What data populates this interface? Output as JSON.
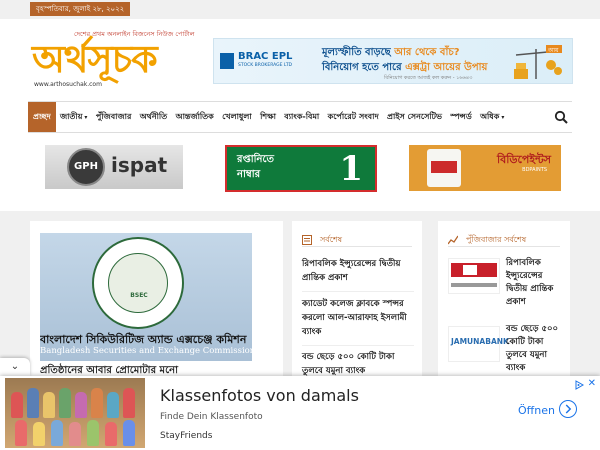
{
  "topbar": {
    "date": "বৃহস্পতিবার, জুলাই ২৮, ২০২২"
  },
  "header": {
    "logo_tagline": "দেশের প্রথম অনলাইন বিজনেস নিউজ পোর্টাল",
    "logo_text": "অর্থসূচক",
    "logo_url": "www.arthosuchak.com",
    "banner": {
      "brand": "BRAC EPL",
      "brand_sub": "STOCK BROKERAGE LTD",
      "line1_a": "মূল্যস্ফীতি বাড়ছে",
      "line1_b": "আর থেকে বাঁচ?",
      "line2_a": "বিনিয়োগ হতে পারে",
      "line2_b": "এক্সট্রা আয়ের উপায়",
      "line3": "বিনিয়োগ করতে আজই কল করুন - ১৬৬৪৩",
      "art_label": "আয়"
    }
  },
  "nav": {
    "items": [
      {
        "label": "প্রচ্ছদ",
        "active": true
      },
      {
        "label": "জাতীয়",
        "caret": true
      },
      {
        "label": "পুঁজিবাজার"
      },
      {
        "label": "অর্থনীতি"
      },
      {
        "label": "আন্তর্জাতিক"
      },
      {
        "label": "খেলাধুলা"
      },
      {
        "label": "শিক্ষা"
      },
      {
        "label": "ব্যাংক-বিমা"
      },
      {
        "label": "কর্পোরেট সংবাদ"
      },
      {
        "label": "প্রাইস সেনসেটিভ"
      },
      {
        "label": "স্পন্সর্ড"
      },
      {
        "label": "অধিক",
        "caret": true
      }
    ]
  },
  "ads": {
    "gph_logo": "GPH",
    "gph_text": "ispat",
    "rapta_line1": "রপ্তানিতে",
    "rapta_line2": "নাম্বার",
    "rapta_num": "1",
    "bidi_text": "বিডিপেইন্টস",
    "bidi_sub": "BDPAINTS"
  },
  "main_story": {
    "img_seal_label": "BSEC",
    "img_bn": "বাংলাদেশ সিকিউরিটিজ অ্যান্ড এক্সচেঞ্জ কমিশন",
    "img_en": "Bangladesh Securities and Exchange Commission",
    "headline": "প্রতিষ্ঠানের আবার প্রোমোটার মনো"
  },
  "latest": {
    "title": "সর্বশেষ",
    "items": [
      "রিপাবলিক ইন্স্যুরেন্সের দ্বিতীয় প্রান্তিক প্রকাশ",
      "ক্যাডেট কলেজ ক্লাবকে স্পন্সর করলো আল-আরাফাহ ইসলামী ব্যাংক",
      "বন্ড ছেড়ে ৫০০ কোটি টাকা তুলবে যমুনা ব্যাংক"
    ]
  },
  "market": {
    "title": "পুঁজিবাজার সর্বশেষ",
    "thumb2_label": "JAMUNABANK",
    "items": [
      "রিপাবলিক ইন্স্যুরেন্সের দ্বিতীয় প্রান্তিক প্রকাশ",
      "বন্ড ছেড়ে ৫০০ কোটি টাকা তুলবে যমুনা ব্যাংক"
    ]
  },
  "bottom_ad": {
    "title": "Klassenfotos von damals",
    "subtitle": "Finde Dein Klassenfoto",
    "brand": "StayFriends",
    "cta": "Öffnen"
  },
  "colors": {
    "accent": "#b5642a",
    "logo": "#f2a100",
    "link": "#1a73e8"
  }
}
